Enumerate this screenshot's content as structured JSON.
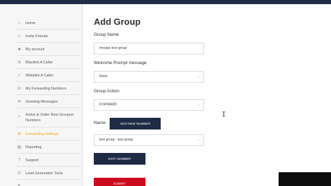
{
  "sidebar": {
    "items": [
      {
        "icon": "home-icon",
        "glyph": "⌂",
        "label": "Home",
        "active": false
      },
      {
        "icon": "invite-icon",
        "glyph": "☺",
        "label": "Invite Friends",
        "active": false
      },
      {
        "icon": "account-icon",
        "glyph": "☻",
        "label": "My account",
        "active": false
      },
      {
        "icon": "blacklist-icon",
        "glyph": "⊘",
        "label": "Blacklist A Caller",
        "active": false
      },
      {
        "icon": "whitelist-icon",
        "glyph": "✓",
        "label": "Whitelist A Caller",
        "active": false
      },
      {
        "icon": "forwarding-icon",
        "glyph": "☏",
        "label": "My Forwarding Numbers",
        "active": false
      },
      {
        "icon": "greeting-icon",
        "glyph": "✉",
        "label": "Greeting Messages",
        "active": false
      },
      {
        "icon": "plus-icon",
        "glyph": "+",
        "label": "Active & Order New Groupon Numbers",
        "active": false
      },
      {
        "icon": "settings-icon",
        "glyph": "⚙",
        "label": "Forwarding Settings",
        "active": true
      },
      {
        "icon": "reporting-icon",
        "glyph": "▤",
        "label": "Reporting",
        "active": false
      },
      {
        "icon": "support-icon",
        "glyph": "?",
        "label": "Support",
        "active": false
      },
      {
        "icon": "leadgen-icon",
        "glyph": "☷",
        "label": "Lead Generation Tools",
        "active": false
      },
      {
        "icon": "extra-icon",
        "glyph": "▸",
        "label": "",
        "active": false
      }
    ]
  },
  "main": {
    "title": "Add Group",
    "group_name_label": "Group Name",
    "group_name_value": "moojan test group",
    "welcome_label": "Welcome Prompt message",
    "welcome_value": "None",
    "action_label": "Group Action",
    "action_value": "FORWARD",
    "name_label": "Name",
    "add_number_button": "ADD NEW NUMBER",
    "name_select_value": "test group - test group",
    "edit_number_button": "EDIT NUMBER",
    "submit_button": "SUBMIT"
  },
  "colors": {
    "navy": "#1f2b45",
    "accent_orange": "#f2a71b",
    "submit_red": "#cc0a1e"
  }
}
